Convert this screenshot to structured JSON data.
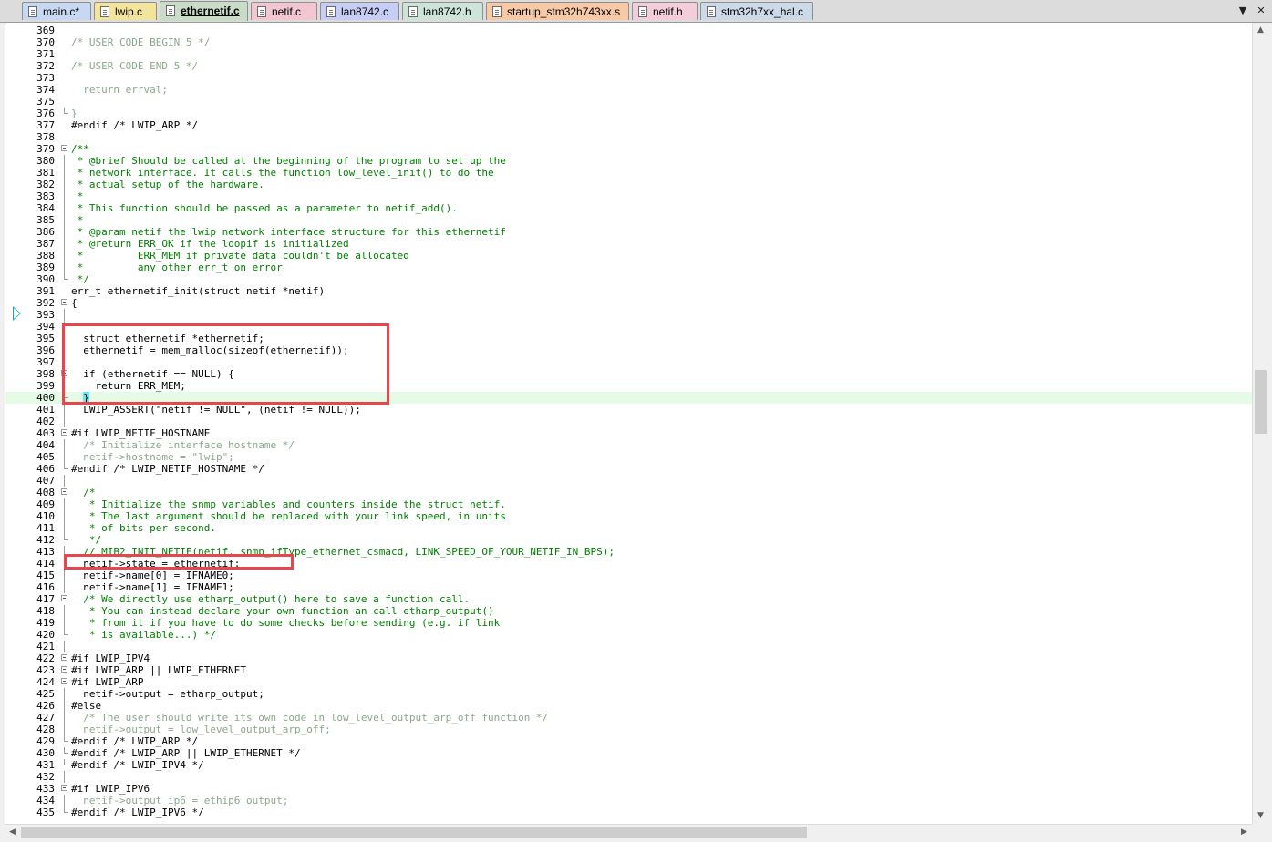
{
  "tabs": [
    {
      "label": "main.c*",
      "color": "#c7d9f2",
      "active": false
    },
    {
      "label": "lwip.c",
      "color": "#f3e49b",
      "active": false
    },
    {
      "label": "ethernetif.c",
      "color": "#c8dcc7",
      "active": true
    },
    {
      "label": "netif.c",
      "color": "#f3c7d2",
      "active": false
    },
    {
      "label": "lan8742.c",
      "color": "#c7cef5",
      "active": false
    },
    {
      "label": "lan8742.h",
      "color": "#cde4d8",
      "active": false
    },
    {
      "label": "startup_stm32h743xx.s",
      "color": "#f7c9a6",
      "active": false
    },
    {
      "label": "netif.h",
      "color": "#f3cdd9",
      "active": false
    },
    {
      "label": "stm32h7xx_hal.c",
      "color": "#cbd9e8",
      "active": false
    }
  ],
  "tab_controls": {
    "dropdown_icon": "chevron-down-icon",
    "close_icon": "close-icon",
    "dropdown": "▼",
    "close": "✕"
  },
  "editor": {
    "current_line": 400,
    "execution_line": 391,
    "lines": [
      {
        "n": "369",
        "t": "",
        "s": "plain",
        "f": ""
      },
      {
        "n": "370",
        "t": "/* USER CODE BEGIN 5 */",
        "s": "faint",
        "f": ""
      },
      {
        "n": "371",
        "t": "",
        "s": "plain",
        "f": ""
      },
      {
        "n": "372",
        "t": "/* USER CODE END 5 */",
        "s": "faint",
        "f": ""
      },
      {
        "n": "373",
        "t": "",
        "s": "plain",
        "f": ""
      },
      {
        "n": "374",
        "t": "  return errval;",
        "s": "faint",
        "f": ""
      },
      {
        "n": "375",
        "t": "",
        "s": "plain",
        "f": ""
      },
      {
        "n": "376",
        "t": "}",
        "s": "faint",
        "f": "end"
      },
      {
        "n": "377",
        "t": "#endif /* LWIP_ARP */",
        "s": "pre",
        "f": ""
      },
      {
        "n": "378",
        "t": "",
        "s": "plain",
        "f": ""
      },
      {
        "n": "379",
        "t": "/**",
        "s": "comment",
        "f": "box"
      },
      {
        "n": "380",
        "t": " * @brief Should be called at the beginning of the program to set up the",
        "s": "comment",
        "f": "line"
      },
      {
        "n": "381",
        "t": " * network interface. It calls the function low_level_init() to do the",
        "s": "comment",
        "f": "line"
      },
      {
        "n": "382",
        "t": " * actual setup of the hardware.",
        "s": "comment",
        "f": "line"
      },
      {
        "n": "383",
        "t": " *",
        "s": "comment",
        "f": "line"
      },
      {
        "n": "384",
        "t": " * This function should be passed as a parameter to netif_add().",
        "s": "comment",
        "f": "line"
      },
      {
        "n": "385",
        "t": " *",
        "s": "comment",
        "f": "line"
      },
      {
        "n": "386",
        "t": " * @param netif the lwip network interface structure for this ethernetif",
        "s": "comment",
        "f": "line"
      },
      {
        "n": "387",
        "t": " * @return ERR_OK if the loopif is initialized",
        "s": "comment",
        "f": "line"
      },
      {
        "n": "388",
        "t": " *         ERR_MEM if private data couldn't be allocated",
        "s": "comment",
        "f": "line"
      },
      {
        "n": "389",
        "t": " *         any other err_t on error",
        "s": "comment",
        "f": "line"
      },
      {
        "n": "390",
        "t": " */",
        "s": "comment",
        "f": "end"
      },
      {
        "n": "391",
        "t": "err_t ethernetif_init(struct netif *netif)",
        "s": "plain",
        "f": ""
      },
      {
        "n": "392",
        "t": "{",
        "s": "plain",
        "f": "box"
      },
      {
        "n": "393",
        "t": "",
        "s": "plain",
        "f": "line"
      },
      {
        "n": "394",
        "t": "",
        "s": "plain",
        "f": "line"
      },
      {
        "n": "395",
        "t": "  struct ethernetif *ethernetif;",
        "s": "plain",
        "f": "line"
      },
      {
        "n": "396",
        "t": "  ethernetif = mem_malloc(sizeof(ethernetif));",
        "s": "plain",
        "f": "line"
      },
      {
        "n": "397",
        "t": "",
        "s": "plain",
        "f": "line"
      },
      {
        "n": "398",
        "t": "  if (ethernetif == NULL) {",
        "s": "plain",
        "f": "box"
      },
      {
        "n": "399",
        "t": "    return ERR_MEM;",
        "s": "plain",
        "f": "line"
      },
      {
        "n": "400",
        "t": "  }",
        "s": "plain",
        "f": "end"
      },
      {
        "n": "401",
        "t": "  LWIP_ASSERT(\"netif != NULL\", (netif != NULL));",
        "s": "plain",
        "f": "line"
      },
      {
        "n": "402",
        "t": "",
        "s": "plain",
        "f": "line"
      },
      {
        "n": "403",
        "t": "#if LWIP_NETIF_HOSTNAME",
        "s": "pre",
        "f": "box"
      },
      {
        "n": "404",
        "t": "  /* Initialize interface hostname */",
        "s": "faint",
        "f": "line"
      },
      {
        "n": "405",
        "t": "  netif->hostname = \"lwip\";",
        "s": "faint",
        "f": "line"
      },
      {
        "n": "406",
        "t": "#endif /* LWIP_NETIF_HOSTNAME */",
        "s": "pre",
        "f": "end"
      },
      {
        "n": "407",
        "t": "",
        "s": "plain",
        "f": "line"
      },
      {
        "n": "408",
        "t": "  /*",
        "s": "comment",
        "f": "box"
      },
      {
        "n": "409",
        "t": "   * Initialize the snmp variables and counters inside the struct netif.",
        "s": "comment",
        "f": "line"
      },
      {
        "n": "410",
        "t": "   * The last argument should be replaced with your link speed, in units",
        "s": "comment",
        "f": "line"
      },
      {
        "n": "411",
        "t": "   * of bits per second.",
        "s": "comment",
        "f": "line"
      },
      {
        "n": "412",
        "t": "   */",
        "s": "comment",
        "f": "end"
      },
      {
        "n": "413",
        "t": "  // MIB2_INIT_NETIF(netif, snmp_ifType_ethernet_csmacd, LINK_SPEED_OF_YOUR_NETIF_IN_BPS);",
        "s": "comment",
        "f": "line"
      },
      {
        "n": "414",
        "t": "  netif->state = ethernetif;",
        "s": "plain",
        "f": "line"
      },
      {
        "n": "415",
        "t": "  netif->name[0] = IFNAME0;",
        "s": "plain",
        "f": "line"
      },
      {
        "n": "416",
        "t": "  netif->name[1] = IFNAME1;",
        "s": "plain",
        "f": "line"
      },
      {
        "n": "417",
        "t": "  /* We directly use etharp_output() here to save a function call.",
        "s": "comment",
        "f": "box"
      },
      {
        "n": "418",
        "t": "   * You can instead declare your own function an call etharp_output()",
        "s": "comment",
        "f": "line"
      },
      {
        "n": "419",
        "t": "   * from it if you have to do some checks before sending (e.g. if link",
        "s": "comment",
        "f": "line"
      },
      {
        "n": "420",
        "t": "   * is available...) */",
        "s": "comment",
        "f": "end"
      },
      {
        "n": "421",
        "t": "",
        "s": "plain",
        "f": "line"
      },
      {
        "n": "422",
        "t": "#if LWIP_IPV4",
        "s": "pre",
        "f": "box"
      },
      {
        "n": "423",
        "t": "#if LWIP_ARP || LWIP_ETHERNET",
        "s": "pre",
        "f": "box"
      },
      {
        "n": "424",
        "t": "#if LWIP_ARP",
        "s": "pre",
        "f": "box"
      },
      {
        "n": "425",
        "t": "  netif->output = etharp_output;",
        "s": "plain",
        "f": "line"
      },
      {
        "n": "426",
        "t": "#else",
        "s": "pre",
        "f": "line"
      },
      {
        "n": "427",
        "t": "  /* The user should write its own code in low_level_output_arp_off function */",
        "s": "faint",
        "f": "line"
      },
      {
        "n": "428",
        "t": "  netif->output = low_level_output_arp_off;",
        "s": "faint",
        "f": "line"
      },
      {
        "n": "429",
        "t": "#endif /* LWIP_ARP */",
        "s": "pre",
        "f": "end"
      },
      {
        "n": "430",
        "t": "#endif /* LWIP_ARP || LWIP_ETHERNET */",
        "s": "pre",
        "f": "end"
      },
      {
        "n": "431",
        "t": "#endif /* LWIP_IPV4 */",
        "s": "pre",
        "f": "end"
      },
      {
        "n": "432",
        "t": "",
        "s": "plain",
        "f": "line"
      },
      {
        "n": "433",
        "t": "#if LWIP_IPV6",
        "s": "pre",
        "f": "box"
      },
      {
        "n": "434",
        "t": "  netif->output_ip6 = ethip6_output;",
        "s": "faint",
        "f": "line"
      },
      {
        "n": "435",
        "t": "#endif /* LWIP_IPV6 */",
        "s": "pre",
        "f": "end"
      }
    ]
  },
  "colors": {
    "highlight_box": "#e8464d",
    "current_line": "#e6fbe6",
    "comment": "#008000",
    "execution_arrow": "#19a3c4"
  },
  "scrollbars": {
    "up_arrow": "▲",
    "down_arrow": "▼",
    "left_arrow": "◀",
    "right_arrow": "▶",
    "vertical_position": 0.47,
    "horizontal_position": 0.0
  }
}
